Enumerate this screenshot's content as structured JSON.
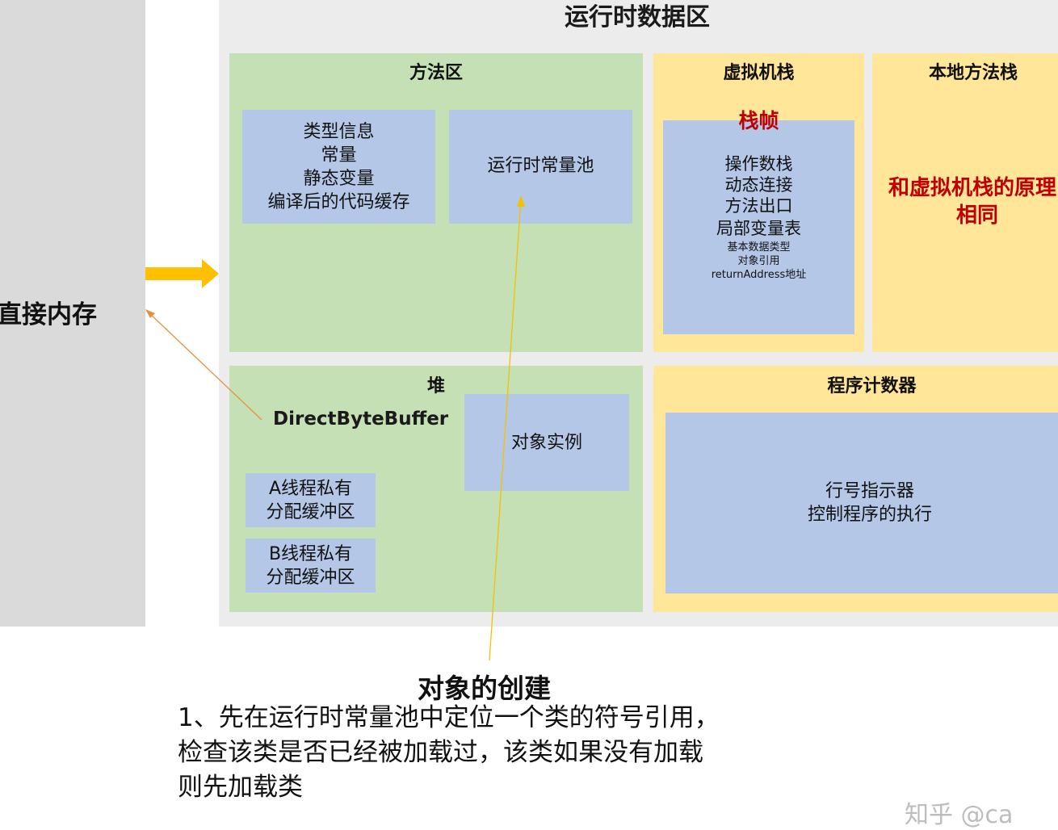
{
  "direct_memory": {
    "label": "直接内存"
  },
  "runtime_area": {
    "title": "运行时数据区"
  },
  "method_area": {
    "title": "方法区",
    "class_info_lines": [
      "类型信息",
      "常量",
      "静态变量",
      "编译后的代码缓存"
    ],
    "runtime_constant_pool": "运行时常量池"
  },
  "vm_stack": {
    "title": "虚拟机栈",
    "frame_label": "栈帧",
    "frame_items": [
      "操作数栈",
      "动态连接",
      "方法出口",
      "局部变量表"
    ],
    "local_var_details": [
      "基本数据类型",
      "对象引用",
      "returnAddress地址"
    ]
  },
  "native_stack": {
    "title": "本地方法栈",
    "note_lines": [
      "和虚拟机栈的原理",
      "相同"
    ]
  },
  "heap": {
    "title": "堆",
    "direct_byte_buffer": "DirectByteBuffer",
    "object_instance": "对象实例",
    "tlab_a": [
      "A线程私有",
      "分配缓冲区"
    ],
    "tlab_b": [
      "B线程私有",
      "分配缓冲区"
    ]
  },
  "pc_register": {
    "title": "程序计数器",
    "lines": [
      "行号指示器",
      "控制程序的执行"
    ]
  },
  "note": {
    "title": "对象的创建",
    "body_lines": [
      "1、先在运行时常量池中定位一个类的符号引用，",
      "检查该类是否已经被加载过，该类如果没有加载",
      "则先加载类"
    ]
  },
  "watermark": "知乎 @ca",
  "colors": {
    "method_heap_bg": "#c5e0b4",
    "stack_bg": "#ffe699",
    "inner_box_bg": "#b4c7e7",
    "runtime_bg": "#ececec",
    "direct_mem_bg": "#dadada",
    "arrow": "#ffc000",
    "thin_line": "#e6913f",
    "red_text": "#c00000"
  }
}
